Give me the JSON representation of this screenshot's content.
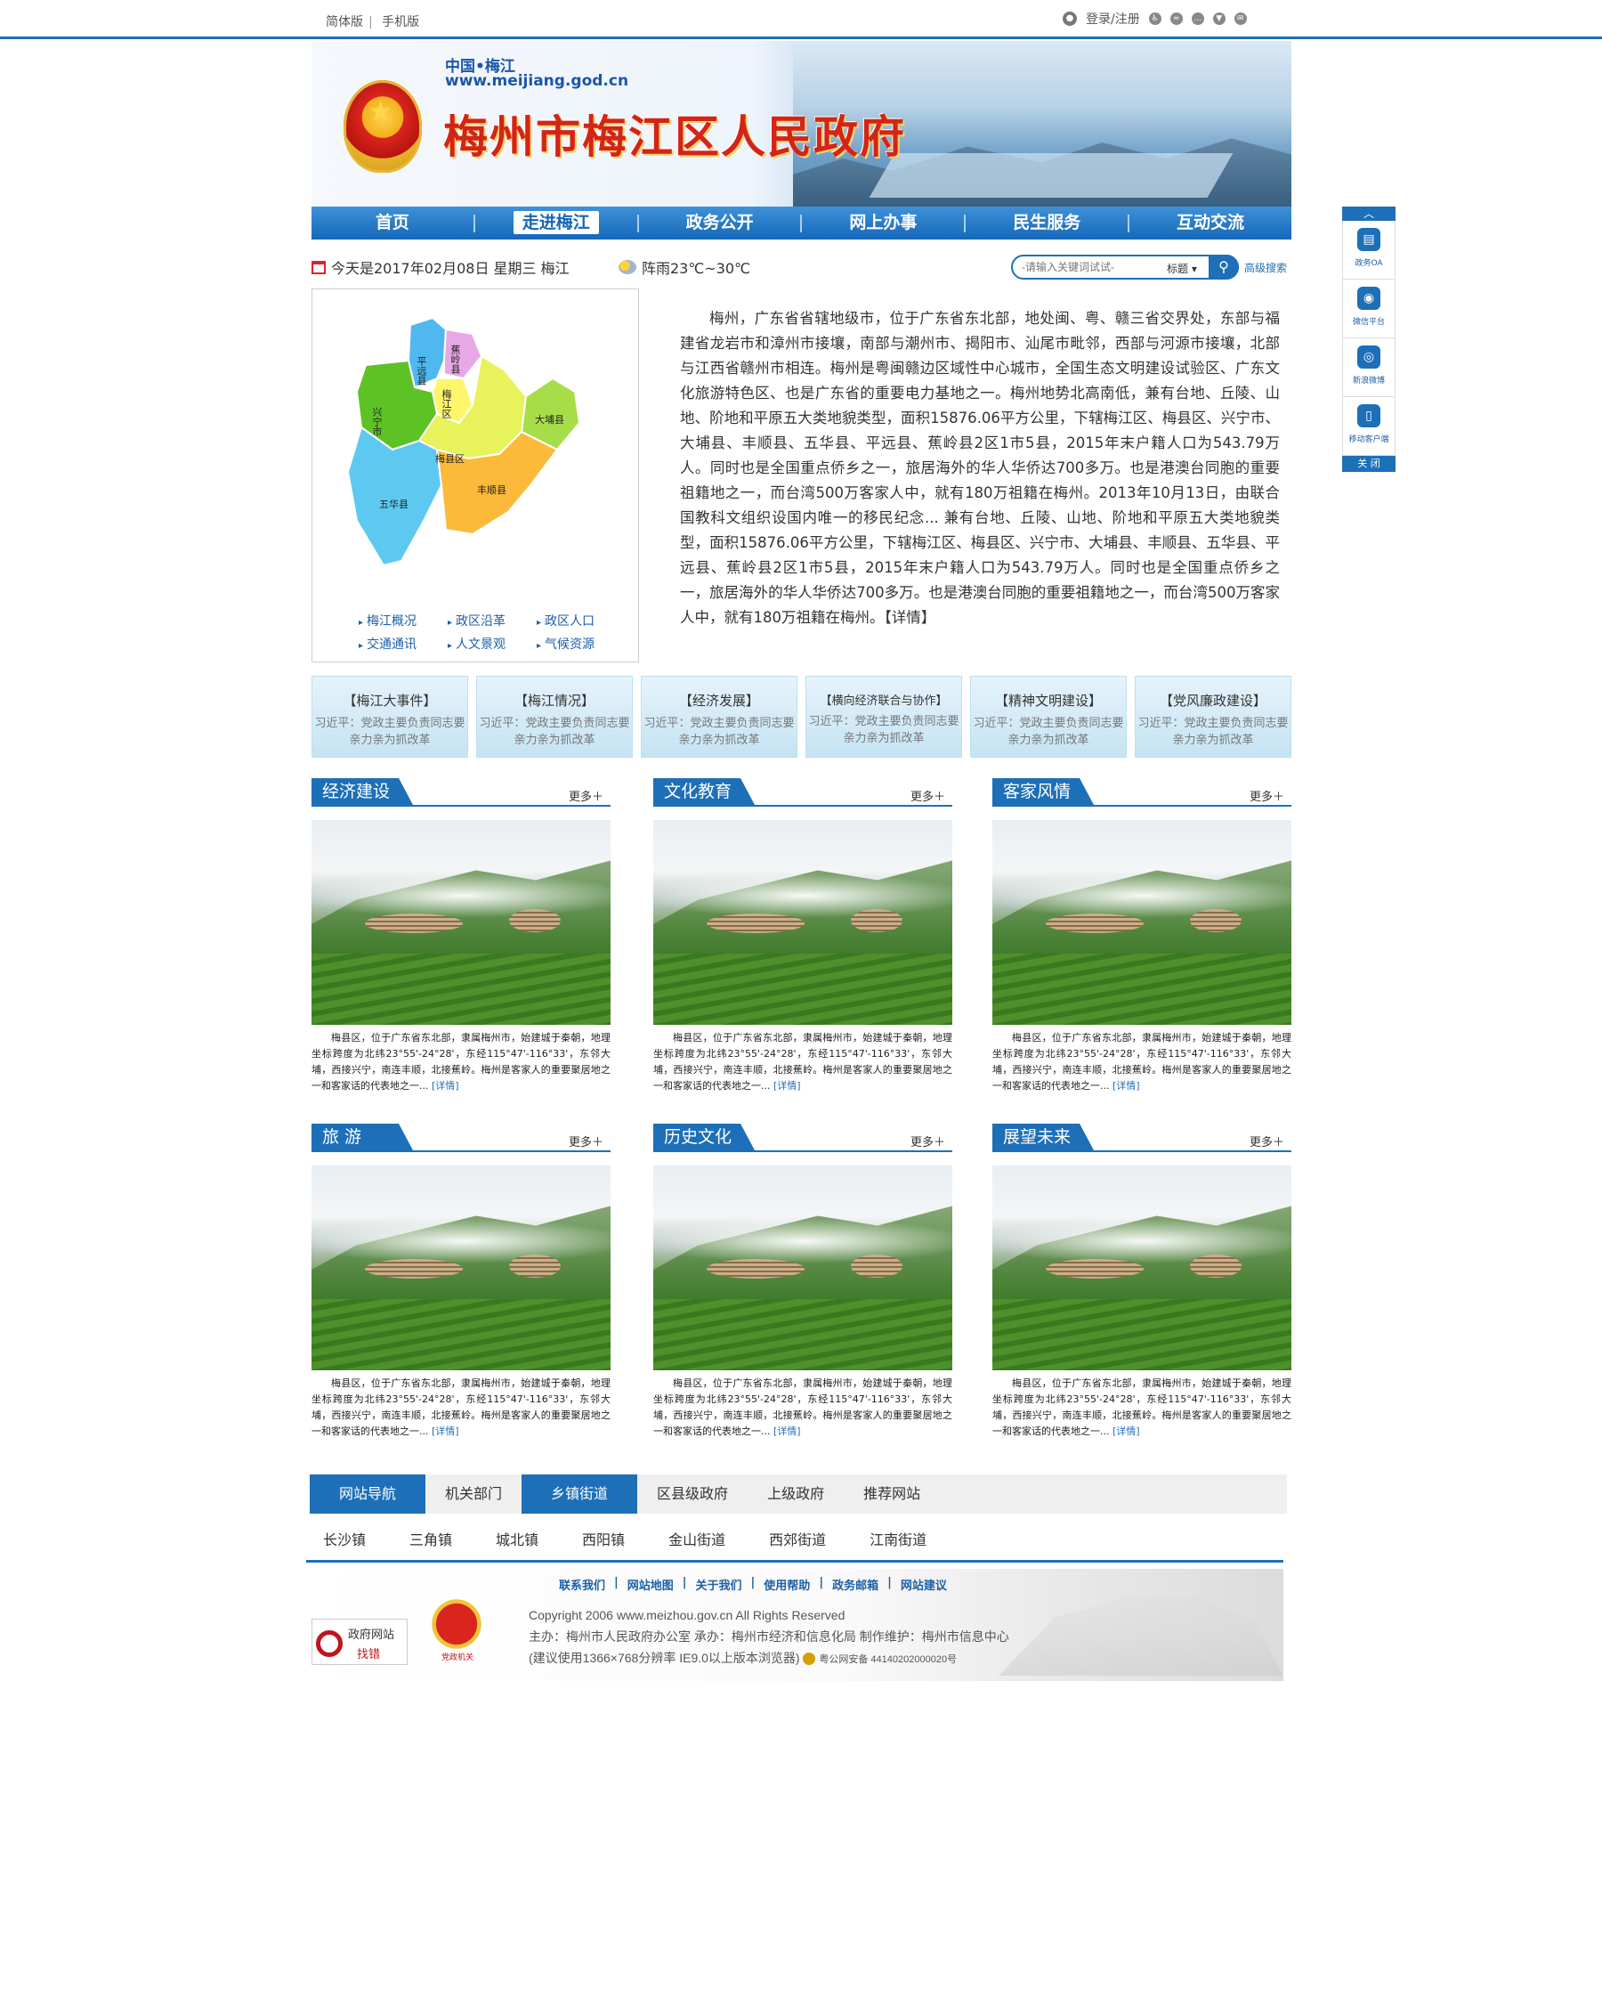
{
  "topbar": {
    "simple": "简体版",
    "mobile": "手机版",
    "login": "登录/注册",
    "icons": [
      "user-icon",
      "accessibility-icon",
      "rss-icon",
      "chat-icon",
      "location-icon",
      "mail-icon"
    ]
  },
  "banner": {
    "sub1": "中国•梅江",
    "sub2": "www.meijiang.god.cn",
    "title": "梅州市梅江区人民政府"
  },
  "nav": {
    "items": [
      "首页",
      "走进梅江",
      "政务公开",
      "网上办事",
      "民生服务",
      "互动交流"
    ],
    "active_index": 1
  },
  "info": {
    "date": "今天是2017年02月08日  星期三  梅江",
    "weather": "阵雨23℃~30℃",
    "search_placeholder": "-请输入关键词试试-",
    "search_type": "标题",
    "advanced": "高级搜索"
  },
  "map": {
    "regions": [
      "平远县",
      "蕉岭县",
      "梅江区",
      "兴宁市",
      "梅县区",
      "大埔县",
      "五华县",
      "丰顺县"
    ],
    "links": [
      "梅江概况",
      "政区沿革",
      "政区人口",
      "交通通讯",
      "人文景观",
      "气候资源"
    ]
  },
  "intro": "梅州，广东省省辖地级市，位于广东省东北部，地处闽、粤、赣三省交界处，东部与福建省龙岩市和漳州市接壤，南部与潮州市、揭阳市、汕尾市毗邻，西部与河源市接壤，北部与江西省赣州市相连。梅州是粤闽赣边区域性中心城市，全国生态文明建设试验区、广东文化旅游特色区、也是广东省的重要电力基地之一。梅州地势北高南低，兼有台地、丘陵、山地、阶地和平原五大类地貌类型，面积15876.06平方公里，下辖梅江区、梅县区、兴宁市、大埔县、丰顺县、五华县、平远县、蕉岭县2区1市5县，2015年末户籍人口为543.79万人。同时也是全国重点侨乡之一，旅居海外的华人华侨达700多万。也是港澳台同胞的重要祖籍地之一，而台湾500万客家人中，就有180万祖籍在梅州。2013年10月13日，由联合国教科文组织设国内唯一的移民纪念...   兼有台地、丘陵、山地、阶地和平原五大类地貌类型，面积15876.06平方公里，下辖梅江区、梅县区、兴宁市、大埔县、丰顺县、五华县、平远县、蕉岭县2区1市5县，2015年末户籍人口为543.79万人。同时也是全国重点侨乡之一，旅居海外的华人华侨达700多万。也是港澳台同胞的重要祖籍地之一，而台湾500万客家人中，就有180万祖籍在梅州。【详情】",
  "cards": [
    {
      "title": "【梅江大事件】",
      "desc": "习近平：党政主要负责同志要亲力亲为抓改革"
    },
    {
      "title": "【梅江情况】",
      "desc": "习近平：党政主要负责同志要亲力亲为抓改革"
    },
    {
      "title": "【经济发展】",
      "desc": "习近平：党政主要负责同志要亲力亲为抓改革"
    },
    {
      "title": "【横向经济联合与协作】",
      "desc": "习近平：党政主要负责同志要亲力亲为抓改革"
    },
    {
      "title": "【精神文明建设】",
      "desc": "习近平：党政主要负责同志要亲力亲为抓改革"
    },
    {
      "title": "【党风廉政建设】",
      "desc": "习近平：党政主要负责同志要亲力亲为抓改革"
    }
  ],
  "sections": [
    {
      "title": "经济建设",
      "more": "更多＋"
    },
    {
      "title": "文化教育",
      "more": "更多＋"
    },
    {
      "title": "客家风情",
      "more": "更多＋"
    },
    {
      "title": "旅  游",
      "more": "更多＋"
    },
    {
      "title": "历史文化",
      "more": "更多＋"
    },
    {
      "title": "展望未来",
      "more": "更多＋"
    }
  ],
  "section_text": "梅县区，位于广东省东北部，隶属梅州市，始建城于秦朝，地理坐标跨度为北纬23°55'-24°28'，东经115°47'-116°33'，东邻大埔，西接兴宁，南连丰顺，北接蕉岭。梅州是客家人的重要聚居地之一和客家话的代表地之一...",
  "section_more": "[详情]",
  "linknav": {
    "tabs": [
      "网站导航",
      "机关部门",
      "乡镇街道",
      "区县级政府",
      "上级政府",
      "推荐网站"
    ],
    "towns": [
      "长沙镇",
      "三角镇",
      "城北镇",
      "西阳镇",
      "金山街道",
      "西郊街道",
      "江南街道"
    ]
  },
  "footer": {
    "links": [
      "联系我们",
      "网站地图",
      "关于我们",
      "使用帮助",
      "政务邮箱",
      "网站建议"
    ],
    "copyright": "Copyright 2006 www.meizhou.gov.cn All Rights Reserved",
    "host": "主办：梅州市人民政府办公室  承办：梅州市经济和信息化局  制作维护：梅州市信息中心",
    "browser": "(建议使用1366×768分辨率 IE9.0以上版本浏览器)",
    "police": "粤公网安备 44140202000020号",
    "badge1_a": "政府网站",
    "badge1_b": "找错",
    "badge2": "党政机关"
  },
  "float": {
    "items": [
      "政务OA",
      "微信平台",
      "新浪微博",
      "移动客户端"
    ],
    "close": "关 闭"
  }
}
